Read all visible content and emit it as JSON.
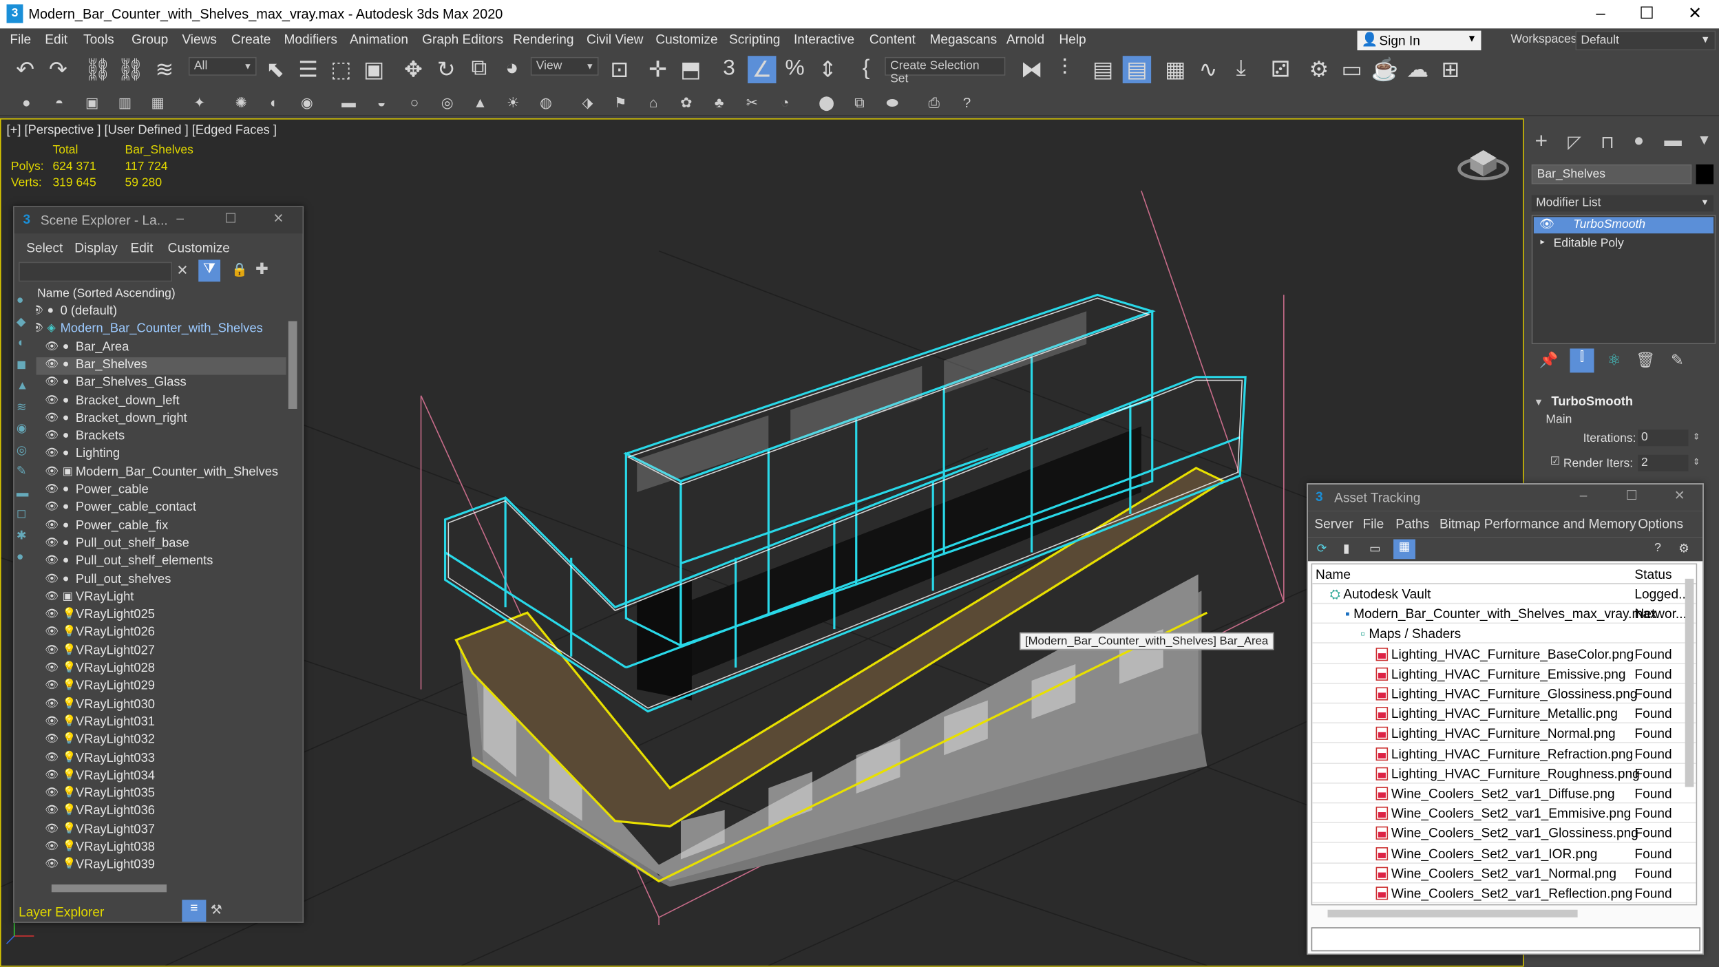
{
  "window": {
    "title": "Modern_Bar_Counter_with_Shelves_max_vray.max - Autodesk 3ds Max 2020",
    "app_icon": "3"
  },
  "menubar": [
    "File",
    "Edit",
    "Tools",
    "Group",
    "Views",
    "Create",
    "Modifiers",
    "Animation",
    "Graph Editors",
    "Rendering",
    "Civil View",
    "Customize",
    "Scripting",
    "Interactive",
    "Content",
    "Megascans",
    "Arnold",
    "Help"
  ],
  "signin": {
    "label": "Sign In"
  },
  "workspaces": {
    "label": "Workspaces:",
    "value": "Default"
  },
  "toolbar": {
    "filter": "All",
    "view": "View",
    "selection_set": "Create Selection Set"
  },
  "viewport": {
    "label": "[+] [Perspective ] [User Defined ] [Edged Faces ]",
    "stats": {
      "total_header": "Total",
      "object_header": "Bar_Shelves",
      "polys_label": "Polys:",
      "polys_total": "624 371",
      "polys_obj": "117 724",
      "verts_label": "Verts:",
      "verts_total": "319 645",
      "verts_obj": "59 280"
    },
    "tooltip": "[Modern_Bar_Counter_with_Shelves] Bar_Area"
  },
  "scene_explorer": {
    "title": "Scene Explorer - La...",
    "menu": [
      "Select",
      "Display",
      "Edit",
      "Customize"
    ],
    "column_header": "Name (Sorted Ascending)",
    "items": [
      {
        "name": "0 (default)",
        "level": 0,
        "icon": "layer"
      },
      {
        "name": "Modern_Bar_Counter_with_Shelves",
        "level": 0,
        "icon": "layer-active",
        "highlight": true
      },
      {
        "name": "Bar_Area",
        "level": 1,
        "icon": "geometry"
      },
      {
        "name": "Bar_Shelves",
        "level": 1,
        "icon": "geometry",
        "selected": true
      },
      {
        "name": "Bar_Shelves_Glass",
        "level": 1,
        "icon": "geometry"
      },
      {
        "name": "Bracket_down_left",
        "level": 1,
        "icon": "geometry"
      },
      {
        "name": "Bracket_down_right",
        "level": 1,
        "icon": "geometry"
      },
      {
        "name": "Brackets",
        "level": 1,
        "icon": "geometry"
      },
      {
        "name": "Lighting",
        "level": 1,
        "icon": "geometry"
      },
      {
        "name": "Modern_Bar_Counter_with_Shelves",
        "level": 1,
        "icon": "group"
      },
      {
        "name": "Power_cable",
        "level": 1,
        "icon": "geometry"
      },
      {
        "name": "Power_cable_contact",
        "level": 1,
        "icon": "geometry"
      },
      {
        "name": "Power_cable_fix",
        "level": 1,
        "icon": "geometry"
      },
      {
        "name": "Pull_out_shelf_base",
        "level": 1,
        "icon": "geometry"
      },
      {
        "name": "Pull_out_shelf_elements",
        "level": 1,
        "icon": "geometry"
      },
      {
        "name": "Pull_out_shelves",
        "level": 1,
        "icon": "geometry"
      },
      {
        "name": "VRayLight",
        "level": 1,
        "icon": "group"
      },
      {
        "name": "VRayLight025",
        "level": 1,
        "icon": "light"
      },
      {
        "name": "VRayLight026",
        "level": 1,
        "icon": "light"
      },
      {
        "name": "VRayLight027",
        "level": 1,
        "icon": "light"
      },
      {
        "name": "VRayLight028",
        "level": 1,
        "icon": "light"
      },
      {
        "name": "VRayLight029",
        "level": 1,
        "icon": "light"
      },
      {
        "name": "VRayLight030",
        "level": 1,
        "icon": "light"
      },
      {
        "name": "VRayLight031",
        "level": 1,
        "icon": "light"
      },
      {
        "name": "VRayLight032",
        "level": 1,
        "icon": "light"
      },
      {
        "name": "VRayLight033",
        "level": 1,
        "icon": "light"
      },
      {
        "name": "VRayLight034",
        "level": 1,
        "icon": "light"
      },
      {
        "name": "VRayLight035",
        "level": 1,
        "icon": "light"
      },
      {
        "name": "VRayLight036",
        "level": 1,
        "icon": "light"
      },
      {
        "name": "VRayLight037",
        "level": 1,
        "icon": "light"
      },
      {
        "name": "VRayLight038",
        "level": 1,
        "icon": "light"
      },
      {
        "name": "VRayLight039",
        "level": 1,
        "icon": "light"
      }
    ],
    "footer": "Layer Explorer"
  },
  "command_panel": {
    "object_name": "Bar_Shelves",
    "modifier_list": "Modifier List",
    "stack": [
      "TurboSmooth",
      "Editable Poly"
    ],
    "rollout_title": "TurboSmooth",
    "main_label": "Main",
    "iterations_label": "Iterations:",
    "iterations_value": "0",
    "render_iters_label": "Render Iters:",
    "render_iters_value": "2"
  },
  "asset_tracking": {
    "title": "Asset Tracking",
    "menu": [
      "Server",
      "File",
      "Paths",
      "Bitmap Performance and Memory",
      "Options"
    ],
    "col_name": "Name",
    "col_status": "Status",
    "rows": [
      {
        "name": "Autodesk Vault",
        "status": "Logged...",
        "indent": 0,
        "icon": "vault"
      },
      {
        "name": "Modern_Bar_Counter_with_Shelves_max_vray.max",
        "status": "Networ...",
        "indent": 1,
        "icon": "max"
      },
      {
        "name": "Maps / Shaders",
        "status": "",
        "indent": 2,
        "icon": "folder"
      },
      {
        "name": "Lighting_HVAC_Furniture_BaseColor.png",
        "status": "Found",
        "indent": 3,
        "icon": "png"
      },
      {
        "name": "Lighting_HVAC_Furniture_Emissive.png",
        "status": "Found",
        "indent": 3,
        "icon": "png"
      },
      {
        "name": "Lighting_HVAC_Furniture_Glossiness.png",
        "status": "Found",
        "indent": 3,
        "icon": "png"
      },
      {
        "name": "Lighting_HVAC_Furniture_Metallic.png",
        "status": "Found",
        "indent": 3,
        "icon": "png"
      },
      {
        "name": "Lighting_HVAC_Furniture_Normal.png",
        "status": "Found",
        "indent": 3,
        "icon": "png"
      },
      {
        "name": "Lighting_HVAC_Furniture_Refraction.png",
        "status": "Found",
        "indent": 3,
        "icon": "png"
      },
      {
        "name": "Lighting_HVAC_Furniture_Roughness.png",
        "status": "Found",
        "indent": 3,
        "icon": "png"
      },
      {
        "name": "Wine_Coolers_Set2_var1_Diffuse.png",
        "status": "Found",
        "indent": 3,
        "icon": "png"
      },
      {
        "name": "Wine_Coolers_Set2_var1_Emmisive.png",
        "status": "Found",
        "indent": 3,
        "icon": "png"
      },
      {
        "name": "Wine_Coolers_Set2_var1_Glossiness.png",
        "status": "Found",
        "indent": 3,
        "icon": "png"
      },
      {
        "name": "Wine_Coolers_Set2_var1_IOR.png",
        "status": "Found",
        "indent": 3,
        "icon": "png"
      },
      {
        "name": "Wine_Coolers_Set2_var1_Normal.png",
        "status": "Found",
        "indent": 3,
        "icon": "png"
      },
      {
        "name": "Wine_Coolers_Set2_var1_Reflection.png",
        "status": "Found",
        "indent": 3,
        "icon": "png"
      }
    ]
  },
  "colors": {
    "selection_yellow": "#e8e000",
    "wire_cyan": "#29d8e8",
    "accent_blue": "#5b8fd8",
    "viewport_bg": "#2b2b2b"
  }
}
